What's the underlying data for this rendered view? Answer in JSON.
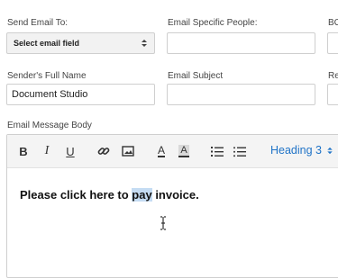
{
  "form": {
    "send_to_label": "Send Email To:",
    "send_to_value": "Select email field",
    "specific_people_label": "Email Specific People:",
    "specific_people_value": "",
    "third_col_label": "BC",
    "sender_name_label": "Sender's Full Name",
    "sender_name_value": "Document Studio",
    "subject_label": "Email Subject",
    "subject_value": "",
    "third_col_label2": "Re",
    "body_label": "Email Message Body"
  },
  "editor": {
    "toolbar": {
      "bold": "B",
      "italic": "I",
      "underline": "U",
      "font_color": "A",
      "highlight": "A",
      "heading_value": "Heading 3"
    },
    "content_before": "Please click here to ",
    "content_selected": "pay",
    "content_after": " invoice."
  },
  "icons": {
    "link": "link-icon",
    "image": "image-icon",
    "ordered_list": "ordered-list-icon",
    "bullet_list": "bullet-list-icon",
    "select_arrows": "chevron-updown-icon",
    "cursor": "text-cursor-icon"
  },
  "colors": {
    "accent": "#1f73c7",
    "selection": "#c5dcf3",
    "border": "#cfcfcf"
  }
}
